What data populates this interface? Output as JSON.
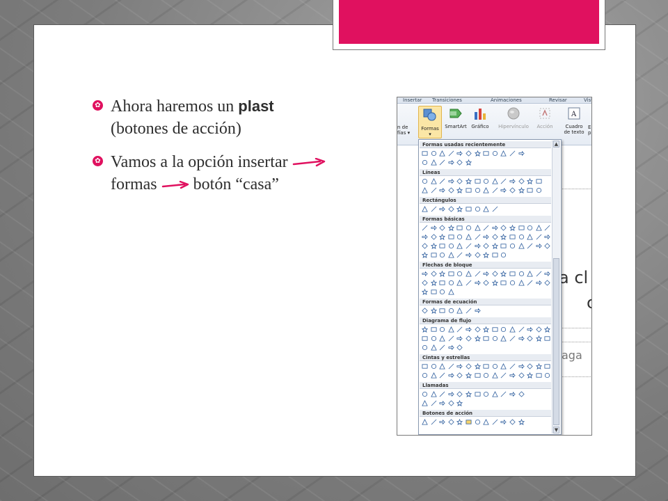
{
  "slide": {
    "accent_color": "#e0115f",
    "bullets": [
      {
        "before": "Ahora haremos un ",
        "emphasis": "plast",
        "after": "(botones de acción)"
      },
      {
        "line1": "Vamos a la opción insertar",
        "line2_a": "formas",
        "line2_b": "botón “casa”"
      }
    ]
  },
  "screenshot": {
    "tabs": [
      "Insertar",
      "Transiciones",
      "Animaciones",
      "Revisar",
      "Vista"
    ],
    "ribbon": {
      "left_partial": [
        "n de",
        "fías ▾"
      ],
      "formas": "Formas",
      "formas_arrow": "▾",
      "smartart": "SmartArt",
      "grafico": "Gráfico",
      "hipervinculo": "Hipervínculo",
      "accion": "Acción",
      "cuadro": [
        "Cuadro",
        "de texto"
      ],
      "right_partial": [
        "E",
        "p"
      ]
    },
    "doc_text": {
      "a": "a cl",
      "b": "c",
      "c": "aga"
    },
    "gallery_sections": [
      "Formas usadas recientemente",
      "Líneas",
      "Rectángulos",
      "Formas básicas",
      "Flechas de bloque",
      "Formas de ecuación",
      "Diagrama de flujo",
      "Cintas y estrellas",
      "Llamadas",
      "Botones de acción"
    ],
    "scroll_up": "▲",
    "scroll_down": "▼"
  }
}
